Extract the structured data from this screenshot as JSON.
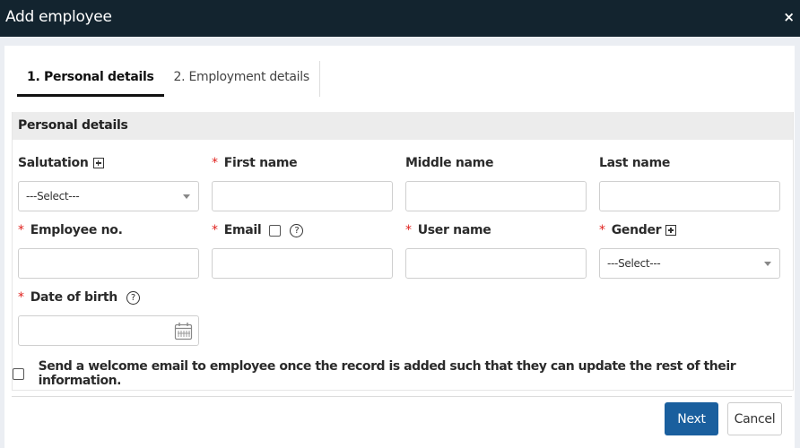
{
  "window": {
    "title": "Add employee",
    "close_glyph": "×"
  },
  "tabs": [
    {
      "label": "1. Personal details",
      "active": true
    },
    {
      "label": "2. Employment details",
      "active": false
    }
  ],
  "section": {
    "title": "Personal details"
  },
  "fields": {
    "salutation": {
      "label": "Salutation",
      "value": "---Select---",
      "required": false
    },
    "first_name": {
      "label": "First name",
      "value": "",
      "required": true
    },
    "middle_name": {
      "label": "Middle name",
      "value": "",
      "required": false
    },
    "last_name": {
      "label": "Last name",
      "value": "",
      "required": false
    },
    "employee_no": {
      "label": "Employee no.",
      "value": "",
      "required": true
    },
    "email": {
      "label": "Email",
      "value": "",
      "required": true,
      "checkbox_checked": false
    },
    "user_name": {
      "label": "User name",
      "value": "",
      "required": true
    },
    "gender": {
      "label": "Gender",
      "value": "---Select---",
      "required": true
    },
    "date_of_birth": {
      "label": "Date of birth",
      "value": "",
      "required": true
    }
  },
  "required_marker": "*",
  "help_glyph": "?",
  "welcome_email": {
    "checked": false,
    "label": "Send a welcome email to employee once the record is added such that they can update the rest of their information."
  },
  "buttons": {
    "next": "Next",
    "cancel": "Cancel"
  },
  "colors": {
    "titlebar": "#13242f",
    "primary": "#1a5f9e",
    "required": "#e0211d"
  }
}
